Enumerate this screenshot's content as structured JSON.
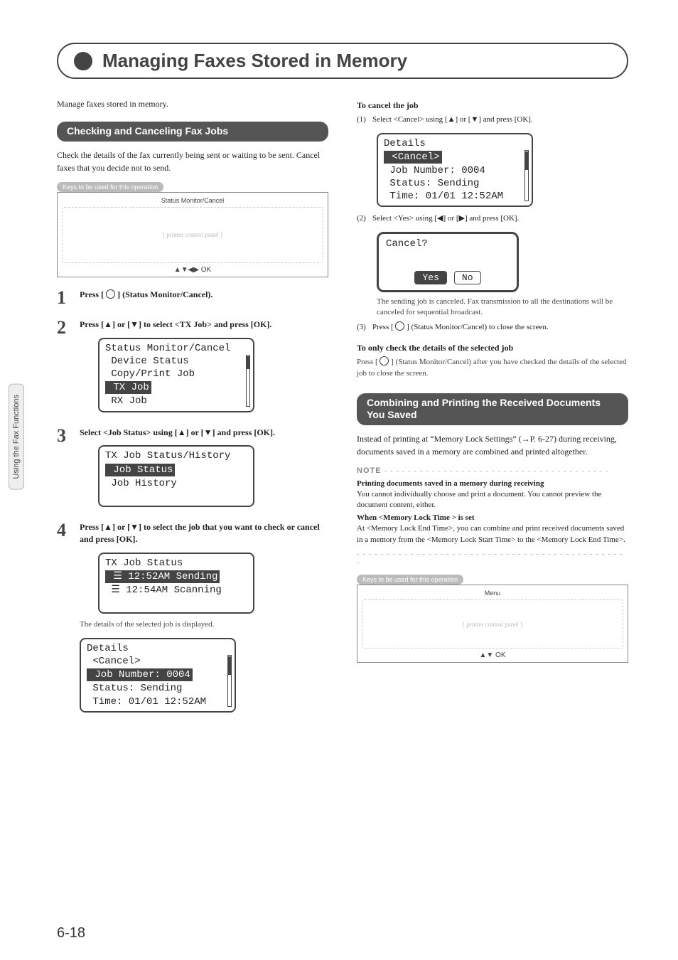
{
  "side_tab": "Using the Fax Functions",
  "title": "Managing Faxes Stored in Memory",
  "intro": "Manage faxes stored in memory.",
  "section1": {
    "heading": "Checking and Canceling Fax Jobs",
    "desc": "Check the details of the fax currently being sent or waiting to be sent. Cancel faxes that you decide not to send.",
    "keys_label": "Keys to be used for this operation",
    "panel_top": "Status Monitor/Cancel",
    "panel_bottom": "▲▼◀▶ OK"
  },
  "steps": {
    "s1": "Press [      ] (Status Monitor/Cancel).",
    "s2": "Press [▲] or [▼] to select <TX Job> and press [OK].",
    "s3": "Select <Job Status> using [▲] or [▼] and press [OK].",
    "s4": "Press [▲] or [▼] to select the job that you want to check or cancel and press [OK].",
    "caption4": "The details of the selected job is displayed."
  },
  "lcd1": {
    "title": "Status Monitor/Cancel",
    "r1": " Device Status",
    "r2": " Copy/Print Job",
    "hl": " TX Job",
    "r4": " RX Job"
  },
  "lcd2": {
    "title": "TX Job Status/History",
    "hl": " Job Status",
    "r2": " Job History"
  },
  "lcd3": {
    "title": "TX Job Status",
    "hl": " ☰ 12:52AM Sending",
    "r2": " ☰ 12:54AM Scanning"
  },
  "lcd4": {
    "title": "Details",
    "r1": " <Cancel>",
    "hl": " Job Number: 0004",
    "r3": " Status: Sending",
    "r4": " Time: 01/01 12:52AM"
  },
  "right": {
    "cancel_h": "To cancel the job",
    "c1": "Select <Cancel> using [▲] or [▼] and press [OK].",
    "lcdA": {
      "title": "Details",
      "hl": " <Cancel>",
      "r2": " Job Number: 0004",
      "r3": " Status: Sending",
      "r4": " Time: 01/01 12:52AM"
    },
    "c2": "Select <Yes> using [◀] or [▶] and press [OK].",
    "prompt": "Cancel?",
    "yes": "Yes",
    "no": "No",
    "c2_note": "The sending job is canceled. Fax transmission to all the destinations will be canceled for sequential broadcast.",
    "c3": "Press [      ] (Status Monitor/Cancel) to close the screen.",
    "only_h": "To only check the details of the selected job",
    "only_b": "Press [      ] (Status Monitor/Cancel) after you have checked the details of the selected job to close the screen."
  },
  "section2": {
    "heading": "Combining and Printing the Received Documents You Saved",
    "desc": "Instead of printing at “Memory Lock Settings” (→P. 6-27) during receiving, documents saved in a memory are combined and printed altogether.",
    "note_label": "NOTE",
    "n1_h": "Printing documents saved in a memory during receiving",
    "n1_b": "You cannot individually choose and print a document. You cannot preview the document content, either.",
    "n2_h": "When <Memory Lock Time > is set",
    "n2_b": "At <Memory Lock End Time>, you can combine and print received documents saved in a memory from the <Memory Lock Start Time> to the <Memory Lock End Time>.",
    "keys_label": "Keys to be used for this operation",
    "panel_top": "Menu",
    "panel_bottom": "▲▼ OK"
  },
  "page_num": "6-18"
}
